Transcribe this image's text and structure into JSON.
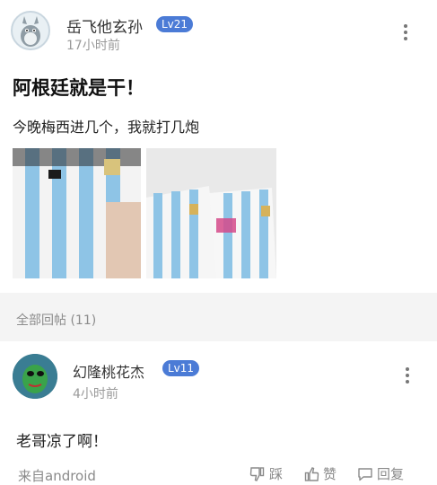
{
  "post": {
    "author": "岳飞他玄孙",
    "level": "Lv21",
    "time": "17小时前",
    "title": "阿根廷就是干！",
    "body": "今晚梅西进几个，我就打几炮"
  },
  "replies_header": "全部回帖 (11)",
  "reply": {
    "author": "幻隆桃花杰",
    "level": "Lv11",
    "time": "4小时前",
    "body": "老哥凉了啊！",
    "source": "来自android",
    "actions": {
      "dislike": "踩",
      "like": "赞",
      "reply": "回复"
    }
  },
  "colors": {
    "level_badge": "#4b7bd6",
    "jersey_blue": "#8ec4e6"
  },
  "icons": [
    "more-vertical-icon",
    "thumb-down-icon",
    "thumb-up-icon",
    "comment-icon"
  ]
}
